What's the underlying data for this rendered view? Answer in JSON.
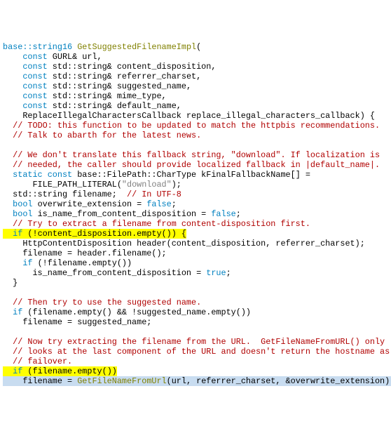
{
  "lines": {
    "l0_a": "base::string16 ",
    "l0_b": "GetSuggestedFilenameImpl",
    "l0_c": "(",
    "l1_a": "    const",
    "l1_b": " GURL& url,",
    "l2_a": "    const",
    "l2_b": " std::string& content_disposition,",
    "l3_a": "    const",
    "l3_b": " std::string& referrer_charset,",
    "l4_a": "    const",
    "l4_b": " std::string& suggested_name,",
    "l5_a": "    const",
    "l5_b": " std::string& mime_type,",
    "l6_a": "    const",
    "l6_b": " std::string& default_name,",
    "l7": "    ReplaceIllegalCharactersCallback replace_illegal_characters_callback) {",
    "l8_a": "  // ",
    "l8_b": "TODO",
    "l8_c": ": this function to be updated to match the httpbis recommendations.",
    "l9": "  // Talk to abarth for the latest news.",
    "l10": "",
    "l11": "  // We don't translate this fallback string, \"download\". If localization is",
    "l12": "  // needed, the caller should provide localized fallback in |default_name|.",
    "l13_a": "  static",
    "l13_b": " const",
    "l13_c": " base::FilePath::CharType kFinalFallbackName[] =",
    "l14_a": "      FILE_PATH_LITERAL(",
    "l14_b": "\"download\"",
    "l14_c": ");",
    "l15_a": "  std::string filename;  ",
    "l15_b": "// In UTF-8",
    "l16_a": "  bool",
    "l16_b": " overwrite_extension = ",
    "l16_c": "false",
    "l16_d": ";",
    "l17_a": "  bool",
    "l17_b": " is_name_from_content_disposition = ",
    "l17_c": "false",
    "l17_d": ";",
    "l18": "  // Try to extract a filename from content-disposition first.",
    "l19_a": "  ",
    "l19_b": "if",
    "l19_c": " (!content_disposition.empty()) {",
    "l20": "    HttpContentDisposition header(content_disposition, referrer_charset);",
    "l21": "    filename = header.filename();",
    "l22_a": "    if",
    "l22_b": " (!filename.empty())",
    "l23_a": "      is_name_from_content_disposition = ",
    "l23_b": "true",
    "l23_c": ";",
    "l24": "  }",
    "l25": "",
    "l26": "  // Then try to use the suggested name.",
    "l27_a": "  if",
    "l27_b": " (filename.empty() && !suggested_name.empty())",
    "l28": "    filename = suggested_name;",
    "l29": "",
    "l30": "  // Now try extracting the filename from the URL.  GetFileNameFromURL() only",
    "l31": "  // looks at the last component of the URL and doesn't return the hostname as a",
    "l32": "  // failover.",
    "l33_a": "  ",
    "l33_b": "if",
    "l33_c": " (filename.empty())",
    "l34_a": "    filename = ",
    "l34_b": "GetFileNameFromUrl",
    "l34_c": "(url, referrer_charset, &overwrite_extension);"
  }
}
